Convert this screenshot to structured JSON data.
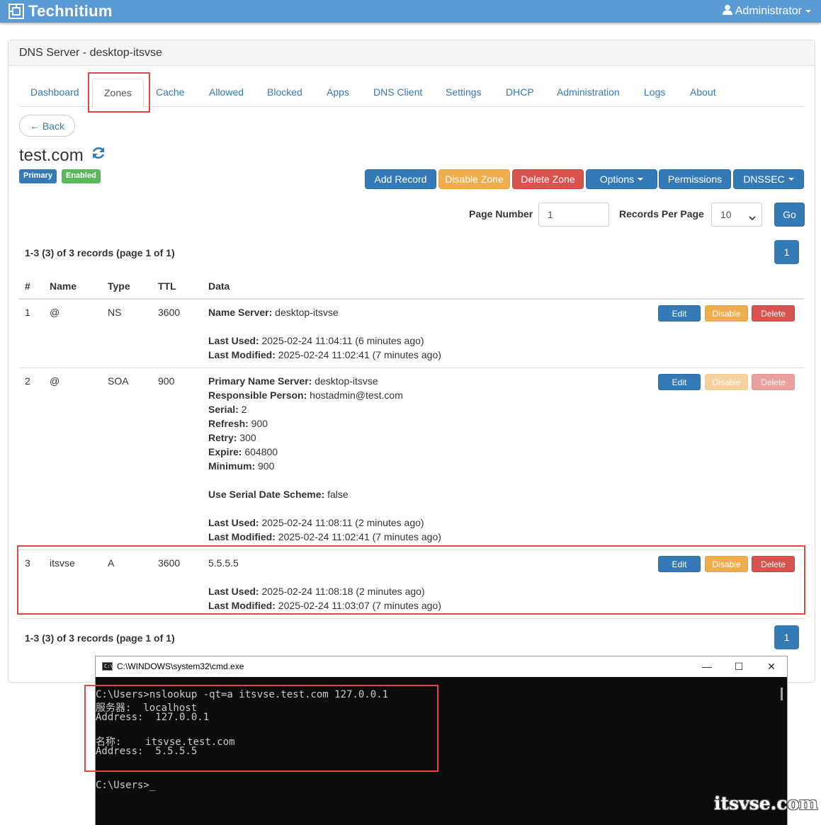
{
  "navbar": {
    "brand": "Technitium",
    "user": "Administrator",
    "colors": {
      "bar": "#5b9bd5"
    }
  },
  "panel": {
    "title": "DNS Server - desktop-itsvse"
  },
  "tabs": [
    {
      "label": "Dashboard"
    },
    {
      "label": "Zones"
    },
    {
      "label": "Cache"
    },
    {
      "label": "Allowed"
    },
    {
      "label": "Blocked"
    },
    {
      "label": "Apps"
    },
    {
      "label": "DNS Client"
    },
    {
      "label": "Settings"
    },
    {
      "label": "DHCP"
    },
    {
      "label": "Administration"
    },
    {
      "label": "Logs"
    },
    {
      "label": "About"
    }
  ],
  "back_label": "← Back",
  "zone": {
    "name": "test.com",
    "badges": {
      "type": "Primary",
      "status": "Enabled"
    }
  },
  "actions": {
    "add_record": "Add Record",
    "disable_zone": "Disable Zone",
    "delete_zone": "Delete Zone",
    "options": "Options",
    "permissions": "Permissions",
    "dnssec": "DNSSEC"
  },
  "paging": {
    "page_number_label": "Page Number",
    "page_number_value": "1",
    "records_per_page_label": "Records Per Page",
    "records_per_page_value": "10",
    "go": "Go",
    "summary": "1-3 (3) of 3 records (page 1 of 1)",
    "current_page": "1"
  },
  "table": {
    "headers": [
      "#",
      "Name",
      "Type",
      "TTL",
      "Data"
    ],
    "row_buttons": {
      "edit": "Edit",
      "disable": "Disable",
      "delete": "Delete"
    },
    "rows": [
      {
        "num": "1",
        "name": "@",
        "type": "NS",
        "ttl": "3600",
        "data": [
          {
            "k": "Name Server:",
            "v": " desktop-itsvse"
          },
          {
            "k": "Last Used:",
            "v": " 2025-02-24 11:04:11 (6 minutes ago)"
          },
          {
            "k": "Last Modified:",
            "v": " 2025-02-24 11:02:41 (7 minutes ago)"
          }
        ]
      },
      {
        "num": "2",
        "name": "@",
        "type": "SOA",
        "ttl": "900",
        "data": [
          {
            "k": "Primary Name Server:",
            "v": " desktop-itsvse"
          },
          {
            "k": "Responsible Person:",
            "v": " hostadmin@test.com"
          },
          {
            "k": "Serial:",
            "v": " 2"
          },
          {
            "k": "Refresh:",
            "v": " 900"
          },
          {
            "k": "Retry:",
            "v": " 300"
          },
          {
            "k": "Expire:",
            "v": " 604800"
          },
          {
            "k": "Minimum:",
            "v": " 900"
          },
          {
            "k": "Use Serial Date Scheme:",
            "v": " false"
          },
          {
            "k": "Last Used:",
            "v": " 2025-02-24 11:08:11 (2 minutes ago)"
          },
          {
            "k": "Last Modified:",
            "v": " 2025-02-24 11:02:41 (7 minutes ago)"
          }
        ]
      },
      {
        "num": "3",
        "name": "itsvse",
        "type": "A",
        "ttl": "3600",
        "data": [
          {
            "k": "",
            "v": "5.5.5.5"
          },
          {
            "k": "Last Used:",
            "v": " 2025-02-24 11:08:18 (2 minutes ago)"
          },
          {
            "k": "Last Modified:",
            "v": " 2025-02-24 11:03:07 (7 minutes ago)"
          }
        ]
      }
    ]
  },
  "cmd": {
    "title": "C:\\WINDOWS\\system32\\cmd.exe",
    "controls": {
      "minimize": "—",
      "maximize": "☐",
      "close": "✕"
    },
    "lines": [
      "C:\\Users>nslookup -qt=a itsvse.test.com 127.0.0.1",
      "服务器:  localhost",
      "Address:  127.0.0.1",
      "",
      "名称:    itsvse.test.com",
      "Address:  5.5.5.5",
      "",
      "C:\\Users>_"
    ]
  },
  "watermark": "itsvse.com"
}
